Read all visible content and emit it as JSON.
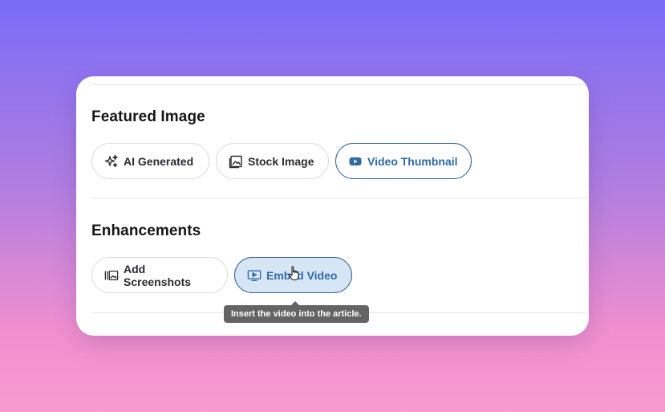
{
  "featured_image": {
    "title": "Featured Image",
    "options": [
      {
        "label": "AI Generated",
        "icon": "sparkles-icon"
      },
      {
        "label": "Stock Image",
        "icon": "image-icon"
      },
      {
        "label": "Video Thumbnail",
        "icon": "youtube-play-icon",
        "selected": true
      }
    ]
  },
  "enhancements": {
    "title": "Enhancements",
    "options": [
      {
        "label": "Add Screenshots",
        "icon": "screenshots-icon"
      },
      {
        "label": "Embed Video",
        "icon": "video-screen-icon",
        "hovered": true
      }
    ],
    "tooltip": "Insert the video into the article."
  },
  "colors": {
    "accent": "#2f6aa6",
    "hover_bg": "#d6e6f5",
    "tooltip_bg": "#646464"
  }
}
